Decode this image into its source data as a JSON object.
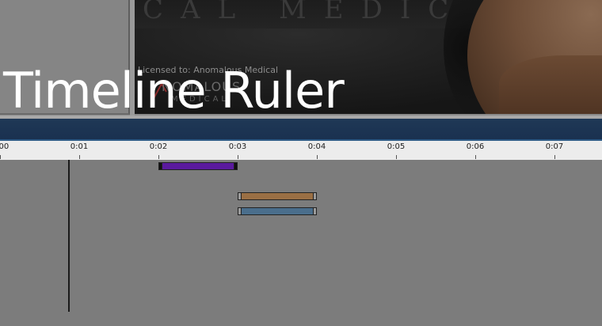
{
  "title": "Timeline Ruler",
  "viewport": {
    "watermark": "CAL MEDIC",
    "license_text": "Licensed to: Anomalous Medical",
    "logo_word": "NOMALOUS",
    "logo_subword": "MEDICAL"
  },
  "ruler": {
    "ticks": [
      "0:00",
      "0:01",
      "0:02",
      "0:03",
      "0:04",
      "0:05",
      "0:06",
      "0:07"
    ]
  },
  "timeline": {
    "playhead_time_s": 0.86,
    "clips": [
      {
        "name": "clip-purple",
        "start_s": 2.0,
        "end_s": 3.0,
        "color": "#5a1a9e"
      },
      {
        "name": "clip-brown",
        "start_s": 3.0,
        "end_s": 4.0,
        "color": "#9a6f44"
      },
      {
        "name": "clip-blue",
        "start_s": 3.0,
        "end_s": 4.0,
        "color": "#4a6e8c"
      }
    ]
  },
  "colors": {
    "header_bar": "#1f3856",
    "ruler_bg": "#ececec",
    "track_bg": "#7c7c7c"
  }
}
